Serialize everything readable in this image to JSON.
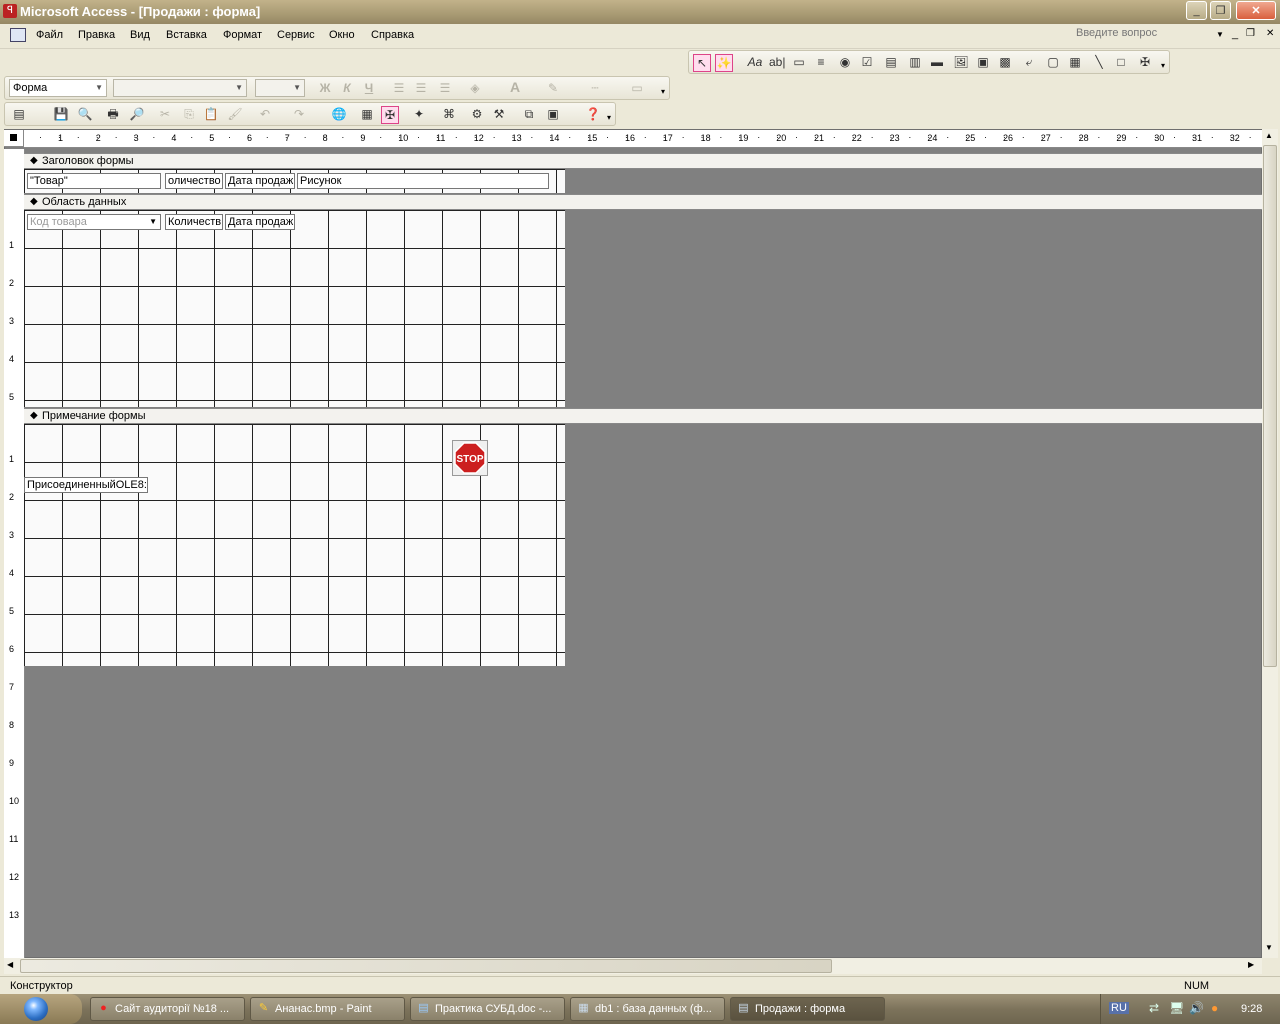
{
  "window": {
    "title": "Microsoft Access - [Продажи : форма]",
    "min_glyph": "_",
    "max_glyph": "❐",
    "close_glyph": "✕"
  },
  "menu": {
    "items": [
      {
        "label": "Файл"
      },
      {
        "label": "Правка"
      },
      {
        "label": "Вид"
      },
      {
        "label": "Вставка"
      },
      {
        "label": "Формат"
      },
      {
        "label": "Сервис"
      },
      {
        "label": "Окно"
      },
      {
        "label": "Справка"
      }
    ],
    "ask_placeholder": "Введите вопрос"
  },
  "format_toolbar": {
    "object_selector": "Форма",
    "bold": "Ж",
    "italic": "К",
    "underline": "Ч",
    "font_color": "A"
  },
  "form_design": {
    "sections": {
      "header": "Заголовок формы",
      "detail": "Область данных",
      "footer": "Примечание формы"
    },
    "header_controls": [
      {
        "text": "\"Товар\""
      },
      {
        "text": "оличество"
      },
      {
        "text": "Дата продажи"
      },
      {
        "text": "Рисунок"
      }
    ],
    "detail_controls": [
      {
        "text": "Код товара"
      },
      {
        "text": "Количеств"
      },
      {
        "text": "Дата продаж"
      }
    ],
    "footer_controls": [
      {
        "text": "ПрисоединенныйOLE8:"
      }
    ],
    "stop_image_text": "STOP",
    "ruler_top_numbers": [
      "1",
      "2",
      "3",
      "4",
      "5",
      "6",
      "7",
      "8",
      "9",
      "10",
      "11",
      "12",
      "13",
      "14",
      "15",
      "16",
      "17",
      "18",
      "19",
      "20",
      "21",
      "22",
      "23",
      "24",
      "25",
      "26",
      "27",
      "28",
      "29",
      "30",
      "31",
      "32"
    ],
    "ruler_left_numbers": {
      "header": [],
      "detail": [
        "1",
        "2",
        "3",
        "4",
        "5"
      ],
      "footer": [
        "1",
        "2",
        "3",
        "4",
        "5",
        "6",
        "7",
        "8",
        "9",
        "10",
        "11",
        "12",
        "13"
      ]
    }
  },
  "status": {
    "mode": "Конструктор",
    "num": "NUM"
  },
  "taskbar": {
    "tasks": [
      {
        "label": "Сайт аудиторії №18 ..."
      },
      {
        "label": "Ананас.bmp - Paint"
      },
      {
        "label": "Практика СУБД.doc -..."
      },
      {
        "label": "db1 : база данных (ф..."
      },
      {
        "label": "Продажи : форма"
      }
    ],
    "lang": "RU",
    "clock": "9:28"
  },
  "colors": {
    "titlebar": "#a89a73",
    "design_bg": "#808080",
    "grid_bg": "#fafafa",
    "stop_red": "#cc1f1f"
  }
}
